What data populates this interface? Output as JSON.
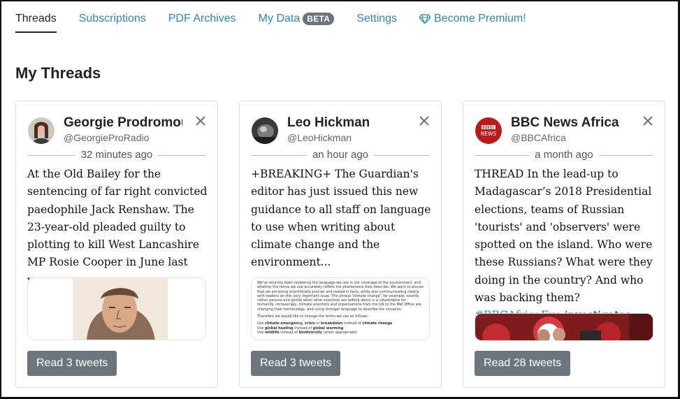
{
  "nav": {
    "items": [
      {
        "label": "Threads",
        "active": true
      },
      {
        "label": "Subscriptions"
      },
      {
        "label": "PDF Archives"
      },
      {
        "label": "My Data",
        "badge": "BETA"
      },
      {
        "label": "Settings"
      },
      {
        "label": "Become Premium!",
        "icon": "diamond-icon"
      }
    ]
  },
  "page": {
    "title": "My Threads"
  },
  "colors": {
    "link": "#2e86c1",
    "button": "#6c757d",
    "bbc_red": "#bb1919"
  },
  "threads": [
    {
      "name": "Georgie Prodromou",
      "handle": "@GeorgieProRadio",
      "time": "32 minutes ago",
      "text": "At the Old Bailey for the sentencing of far right convicted paedophile Jack Renshaw. The 23-year-old pleaded guilty to plotting to kill West Lancashire MP Rosie Cooper in June last year.",
      "button": "Read 3 tweets",
      "avatar_icon": "person-avatar-icon",
      "media_icon": "court-sketch-image"
    },
    {
      "name": "Leo Hickman",
      "handle": "@LeoHickman",
      "time": "an hour ago",
      "text": "+BREAKING+ The Guardian's editor has just issued this new guidance to all staff on language to use when writing about climate change and the environment...",
      "button": "Read 3 tweets",
      "avatar_icon": "person-avatar-icon",
      "media": {
        "para1": "We've recently been reviewing the language we use in our coverage of the environment, and whether the terms we use accurately reflect the phenomena they describe. We want to ensure that we are being scientifically precise and rooted in facts, while also communicating clearly with readers on this very important issue. The phrase 'climate change', for example, sounds rather passive and gentle when what scientists are talking about is a catastrophe for humanity. Increasingly, climate scientists and organisations from the UN to the Met Office are changing their terminology, and using stronger language to describe the situation.",
        "para2": "Therefore we would like to change the terms we use as follows:",
        "line1_a": "Use ",
        "line1_b": "climate emergency, crisis",
        "line1_c": " or ",
        "line1_d": "breakdown",
        "line1_e": " instead of ",
        "line1_f": "climate change",
        "line2_a": "Use ",
        "line2_b": "global heating",
        "line2_c": " instead of ",
        "line2_d": "global warming",
        "line3_a": "Use ",
        "line3_b": "wildlife",
        "line3_c": " instead of ",
        "line3_d": "biodiversity",
        "line3_e": " (when appropriate)"
      }
    },
    {
      "name": "BBC News Africa",
      "handle": "@BBCAfrica",
      "time": "a month ago",
      "text_plain": "THREAD In the lead-up to Madagascar’s 2018 Presidential elections, teams of Russian 'tourists' and 'observers' were spotted on the island. Who were these Russians? What were they doing in the country? And who was backing them? ",
      "hashtag": "#BBCAfricaEye",
      "text_end": " investigates.",
      "button": "Read 28 tweets",
      "logo_line1": "BBC",
      "logo_line2": "NEWS",
      "media_icon": "event-photo-image"
    }
  ]
}
